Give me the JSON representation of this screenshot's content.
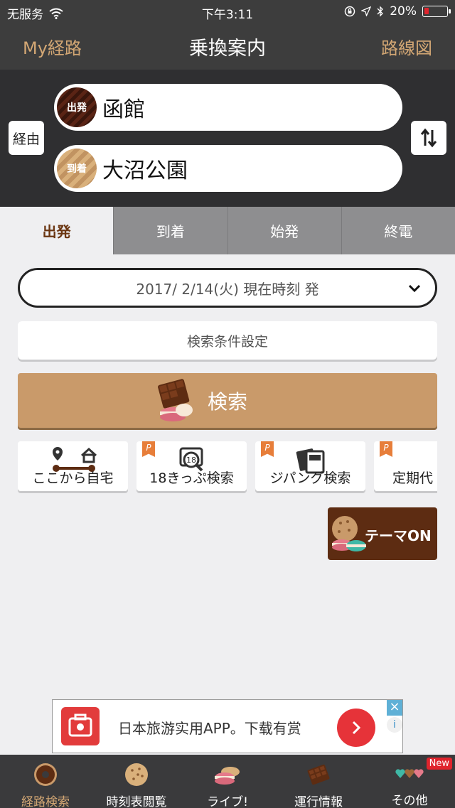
{
  "status_bar": {
    "carrier": "无服务",
    "time": "下午3:11",
    "battery": "20%",
    "battery_level": 0.2
  },
  "nav": {
    "left": "My経路",
    "title": "乗換案内",
    "right": "路線図"
  },
  "stations": {
    "via_label": "経由",
    "departure": {
      "badge": "出発",
      "name": "函館"
    },
    "arrival": {
      "badge": "到着",
      "name": "大沼公園"
    }
  },
  "tabs": [
    "出発",
    "到着",
    "始発",
    "終電"
  ],
  "date_selector": "2017/ 2/14(火) 現在時刻 発",
  "conditions_label": "検索条件設定",
  "search_label": "検索",
  "quick_actions": [
    {
      "label": "ここから自宅",
      "tag": ""
    },
    {
      "label": "18きっぷ検索",
      "tag": "P"
    },
    {
      "label": "ジパング検索",
      "tag": "P"
    },
    {
      "label": "定期代",
      "tag": "P"
    }
  ],
  "theme_button": "テーマON",
  "ad": {
    "text": "日本旅游实用APP。下载有赏"
  },
  "tabbar": {
    "items": [
      "経路検索",
      "時刻表閲覧",
      "ライブ!",
      "運行情報",
      "その他"
    ],
    "new_badge": "New"
  },
  "colors": {
    "accent": "#d3a774",
    "dark": "#3d3d3d",
    "search": "#c99a6a",
    "chocolate": "#5d2c12"
  }
}
